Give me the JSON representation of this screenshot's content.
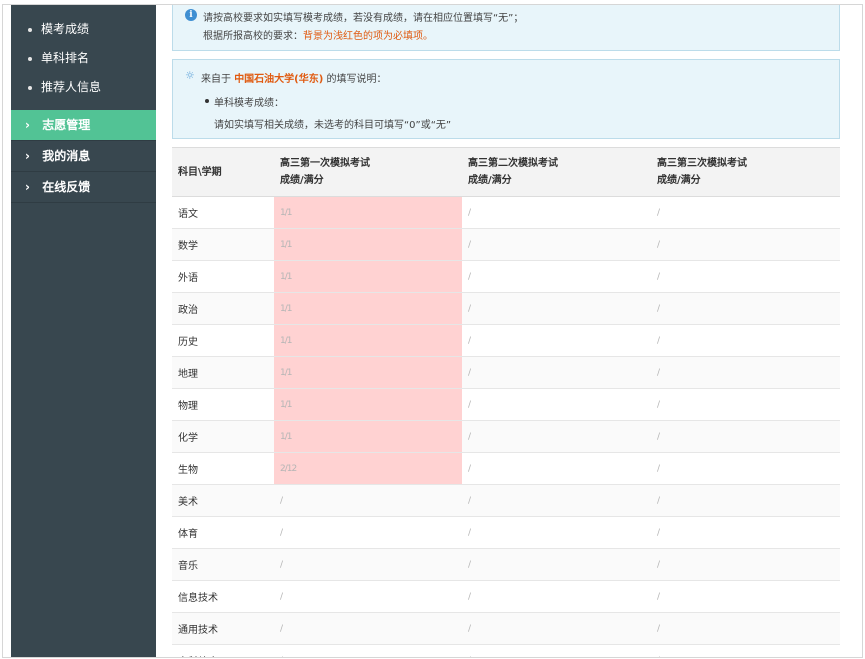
{
  "sidebar": {
    "sub_items": [
      "模考成绩",
      "单科排名",
      "推荐人信息"
    ],
    "menu": [
      {
        "label": "志愿管理",
        "active": true
      },
      {
        "label": "我的消息",
        "active": false
      },
      {
        "label": "在线反馈",
        "active": false
      }
    ]
  },
  "notice": {
    "line1": "请按高校要求如实填写模考成绩，若没有成绩，请在相应位置填写“无”；",
    "line2_prefix": "根据所报高校的要求：",
    "line2_highlight": "背景为浅红色的项为必填项。"
  },
  "instruction": {
    "prefix": "来自于",
    "school": "中国石油大学(华东)",
    "suffix": "的填写说明：",
    "bullet_title": "单科模考成绩：",
    "bullet_text": "请如实填写相关成绩，未选考的科目可填写“0”或“无”"
  },
  "table": {
    "corner_header": "科目\\学期",
    "columns": [
      {
        "line1": "高三第一次模拟考试",
        "line2": "成绩/满分"
      },
      {
        "line1": "高三第二次模拟考试",
        "line2": "成绩/满分"
      },
      {
        "line1": "高三第三次模拟考试",
        "line2": "成绩/满分"
      }
    ],
    "rows": [
      {
        "subject": "语文",
        "values": [
          "1/1",
          "/",
          "/"
        ],
        "required": true
      },
      {
        "subject": "数学",
        "values": [
          "1/1",
          "/",
          "/"
        ],
        "required": true
      },
      {
        "subject": "外语",
        "values": [
          "1/1",
          "/",
          "/"
        ],
        "required": true
      },
      {
        "subject": "政治",
        "values": [
          "1/1",
          "/",
          "/"
        ],
        "required": true
      },
      {
        "subject": "历史",
        "values": [
          "1/1",
          "/",
          "/"
        ],
        "required": true
      },
      {
        "subject": "地理",
        "values": [
          "1/1",
          "/",
          "/"
        ],
        "required": true
      },
      {
        "subject": "物理",
        "values": [
          "1/1",
          "/",
          "/"
        ],
        "required": true
      },
      {
        "subject": "化学",
        "values": [
          "1/1",
          "/",
          "/"
        ],
        "required": true
      },
      {
        "subject": "生物",
        "values": [
          "2/12",
          "/",
          "/"
        ],
        "required": true
      },
      {
        "subject": "美术",
        "values": [
          "/",
          "/",
          "/"
        ],
        "required": false
      },
      {
        "subject": "体育",
        "values": [
          "/",
          "/",
          "/"
        ],
        "required": false
      },
      {
        "subject": "音乐",
        "values": [
          "/",
          "/",
          "/"
        ],
        "required": false
      },
      {
        "subject": "信息技术",
        "values": [
          "/",
          "/",
          "/"
        ],
        "required": false
      },
      {
        "subject": "通用技术",
        "values": [
          "/",
          "/",
          "/"
        ],
        "required": false
      },
      {
        "subject": "文科综合",
        "values": [
          "/",
          "/",
          "/"
        ],
        "required": false
      }
    ]
  },
  "colors": {
    "sidebar_bg": "#38474f",
    "active_menu": "#52c395",
    "required_cell": "#ffd2d2",
    "notice_bg": "#e8f5fa",
    "highlight_text": "#e05a10"
  }
}
